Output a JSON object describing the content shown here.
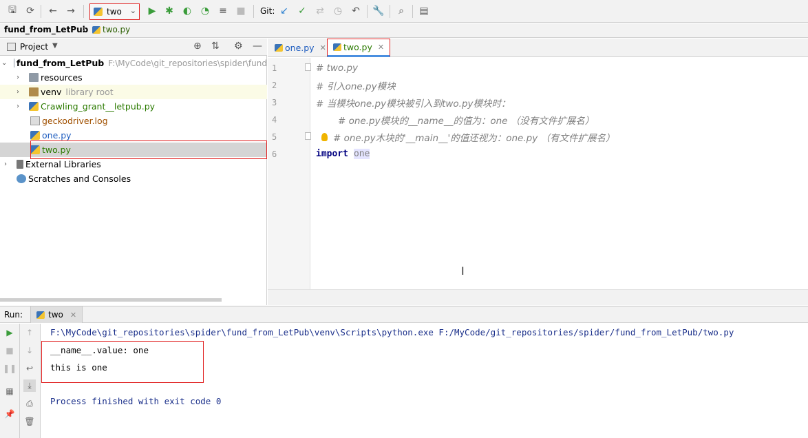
{
  "toolbar": {
    "run_config": "two",
    "git_label": "Git:"
  },
  "breadcrumb": {
    "project": "fund_from_LetPub",
    "file": "two.py"
  },
  "project_panel": {
    "title": "Project",
    "tree": {
      "root_name": "fund_from_LetPub",
      "root_path": "F:\\MyCode\\git_repositories\\spider\\fund",
      "items": [
        {
          "label": "resources"
        },
        {
          "label": "venv",
          "hint": "library root"
        },
        {
          "label": "Crawling_grant__letpub.py"
        },
        {
          "label": "geckodriver.log"
        },
        {
          "label": "one.py"
        },
        {
          "label": "two.py"
        },
        {
          "label": "External Libraries"
        },
        {
          "label": "Scratches and Consoles"
        }
      ]
    }
  },
  "editor": {
    "tabs": [
      {
        "label": "one.py"
      },
      {
        "label": "two.py"
      }
    ],
    "line_numbers": [
      "1",
      "2",
      "3",
      "4",
      "5",
      "6"
    ],
    "lines": [
      "# two.py",
      "# 引入one.py模块",
      "# 当模块one.py模块被引入到two.py模块时：",
      "# one.py模块的__name__的值为：one  （没有文件扩展名）",
      "# one.py木块的'__main__'的值还视为：one.py  （有文件扩展名）",
      {
        "keyword": "import",
        "name": "one"
      }
    ]
  },
  "run_panel": {
    "label": "Run:",
    "tab": "two",
    "output": [
      "F:\\MyCode\\git_repositories\\spider\\fund_from_LetPub\\venv\\Scripts\\python.exe F:/MyCode/git_repositories/spider/fund_from_LetPub/two.py",
      "__name__.value: one",
      "this is one",
      "Process finished with exit code 0"
    ]
  },
  "colors": {
    "highlight_box": "#e02020",
    "comment": "#808080",
    "keyword": "#000080",
    "green_file": "#2b7a00",
    "blue_file": "#1d5cbf"
  }
}
